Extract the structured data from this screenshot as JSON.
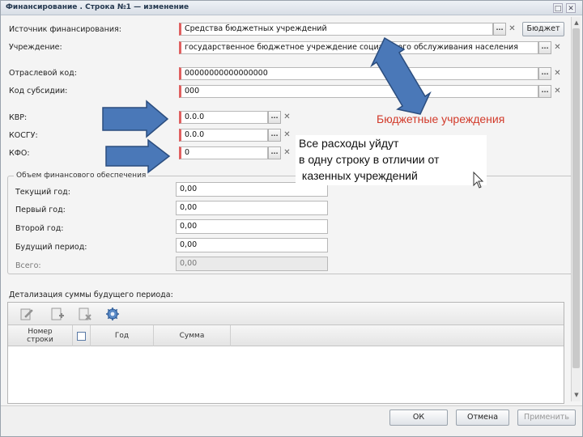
{
  "window": {
    "title": "Финансирование . Строка №1 — изменение"
  },
  "fields": {
    "source": {
      "label": "Источник финансирования:",
      "value": "Средства бюджетных учреждений",
      "button": "Бюджет"
    },
    "institution": {
      "label": "Учреждение:",
      "value": "государственное бюджетное учреждение социального обслуживания населения"
    },
    "sector_code": {
      "label": "Отраслевой код:",
      "value": "00000000000000000"
    },
    "subsidy_code": {
      "label": "Код субсидии:",
      "value": "000"
    },
    "kvr": {
      "label": "КВР:",
      "value": "0.0.0"
    },
    "kosgu": {
      "label": "КОСГУ:",
      "value": "0.0.0"
    },
    "kfo": {
      "label": "КФО:",
      "value": "0"
    }
  },
  "funding_group": {
    "title": "Объем финансового обеспечения",
    "rows": [
      {
        "label": "Текущий год:",
        "value": "0,00"
      },
      {
        "label": "Первый год:",
        "value": "0,00"
      },
      {
        "label": "Второй год:",
        "value": "0,00"
      },
      {
        "label": "Будущий период:",
        "value": "0,00"
      },
      {
        "label": "Всего:",
        "value": "0,00"
      }
    ]
  },
  "detail": {
    "title": "Детализация суммы будущего периода:",
    "columns": {
      "row_number": "Номер строки",
      "year": "Год",
      "sum": "Сумма"
    }
  },
  "footer": {
    "ok": "ОК",
    "cancel": "Отмена",
    "apply": "Применить"
  },
  "annotations": {
    "budget_institutions": "Бюджетные учреждения",
    "note_lines": [
      "Все расходы уйдут",
      "в одну строку в отличии от",
      " казенных учреждений"
    ]
  },
  "colors": {
    "required_marker": "#e06060",
    "annotation_red": "#d23a2a",
    "arrow_fill": "#4a78b8",
    "arrow_stroke": "#2b4d7e"
  }
}
